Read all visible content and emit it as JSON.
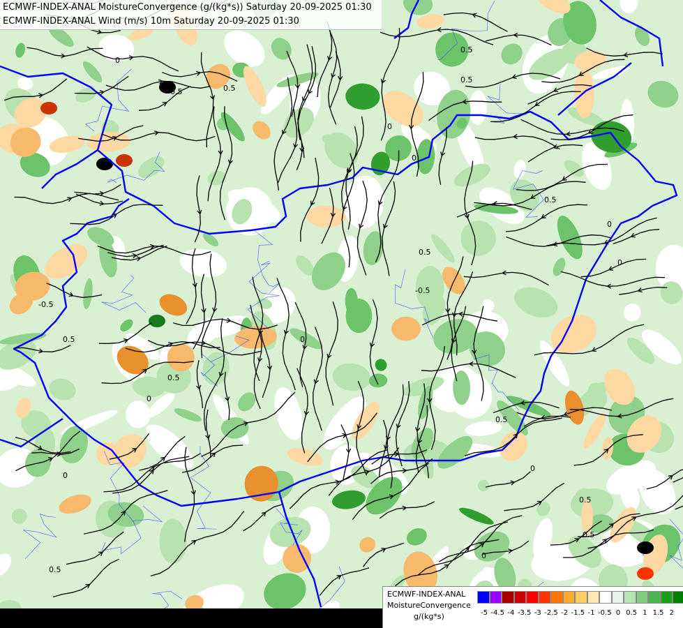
{
  "header": {
    "line1": "ECMWF-INDEX-ANAL MoistureConvergence (g/(kg*s)) Saturday 20-09-2025 01:30",
    "line2": "ECMWF-INDEX-ANAL Wind (m/s) 10m Saturday 20-09-2025 01:30"
  },
  "legend": {
    "title_line1": "ECMWF-INDEX-ANAL",
    "title_line2": "MoistureConvergence",
    "units": "g/(kg*s)",
    "colors": [
      "#0000ff",
      "#9900ff",
      "#aa0000",
      "#cc0000",
      "#ff0000",
      "#ff3300",
      "#ff7700",
      "#ffaa33",
      "#ffcc66",
      "#ffe6b3",
      "#ffffff",
      "#e6f5e6",
      "#b3e6b3",
      "#80cc80",
      "#4db34d",
      "#1a9e1a",
      "#008000"
    ],
    "ticks": [
      "-5",
      "-4.5",
      "-4",
      "-3.5",
      "-3",
      "-2.5",
      "-2",
      "-1.5",
      "-1",
      "-0.5",
      "0",
      "0.5",
      "1",
      "1.5",
      "2"
    ]
  },
  "contour_labels": [
    "0",
    "0.5",
    "-0.5",
    "0",
    "0.5",
    "0.5",
    "0",
    "-0.5",
    "0.5",
    "0",
    "0",
    "0.5",
    "0",
    "0.5",
    "0",
    "-0.5",
    "0.5",
    "0",
    "0.5",
    "0.5",
    "0",
    "0.5",
    "0",
    "0.5"
  ],
  "colors": {
    "border": "#0000ff",
    "river": "#3355ff",
    "streamline": "#000000"
  }
}
